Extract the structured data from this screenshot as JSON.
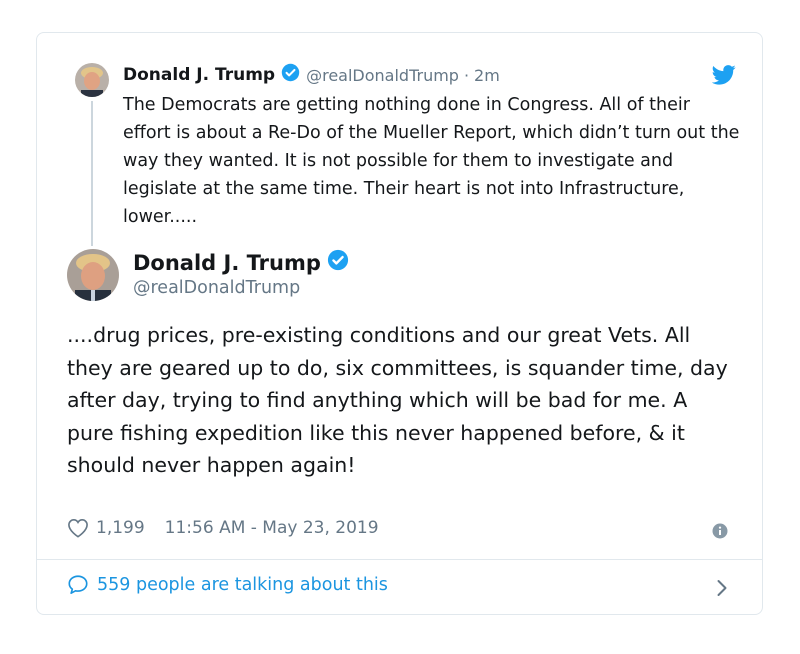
{
  "parent_tweet": {
    "name": "Donald J. Trump",
    "handle": "@realDonaldTrump",
    "separator": "·",
    "time": "2m",
    "text": "The Democrats are getting nothing done in Congress. All of their effort is about a Re-Do of the Mueller Report, which didn’t turn out the way they wanted. It is not possible for them to investigate and legislate at the same time. Their heart is not into Infrastructure, lower....."
  },
  "main_tweet": {
    "name": "Donald J. Trump",
    "handle": "@realDonaldTrump",
    "text": "....drug prices, pre-existing conditions and our great Vets. All they are geared up to do, six committees, is squander time, day after day, trying to find anything which will be bad for me. A pure fishing expedition like this never happened before, & it should never happen again!",
    "likes": "1,199",
    "timestamp": "11:56 AM - May 23, 2019"
  },
  "footer": {
    "talking": "559 people are talking about this"
  },
  "icons": {
    "verified": "verified-badge-icon",
    "bird": "twitter-bird-icon",
    "heart": "heart-icon",
    "info": "info-icon",
    "bubble": "speech-bubble-icon",
    "chevron": "chevron-right-icon"
  },
  "colors": {
    "accent": "#1da1f2",
    "link": "#1b95e0",
    "muted": "#657786",
    "border": "#e1e8ed"
  }
}
